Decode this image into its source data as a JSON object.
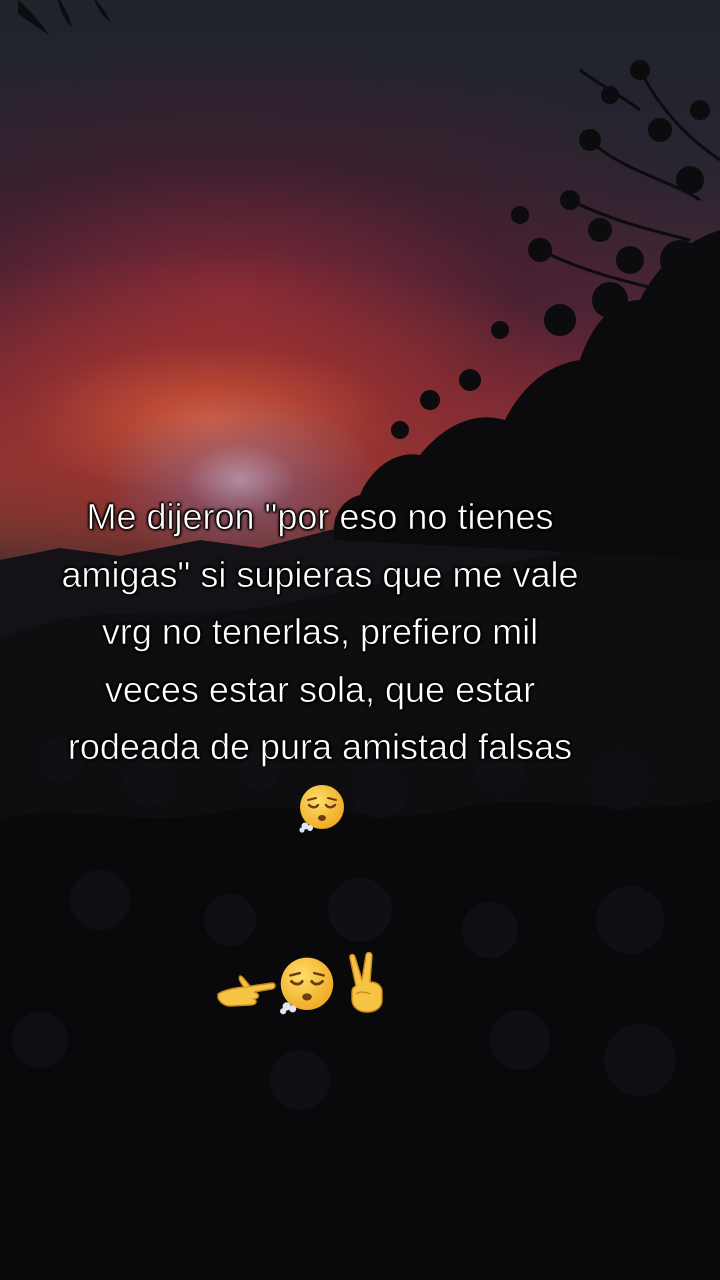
{
  "caption": {
    "lines": [
      "Me dijeron \"por eso no tienes",
      "amigas\" si supieras que me vale",
      "vrg no tenerlas, prefiero mil",
      "veces estar sola, que estar",
      "rodeada de pura amistad falsas"
    ]
  },
  "emojis": {
    "caption_end": "exhaling-face",
    "row": [
      "pointing-hand",
      "exhaling-face",
      "victory-hand"
    ]
  },
  "colors": {
    "sky_top": "#1e232c",
    "sunset_red": "#8e3a3a",
    "sun_glow": "#c8d2ff",
    "foliage": "#08080a",
    "text": "#ffffff",
    "emoji_yellow": "#f6c445"
  }
}
